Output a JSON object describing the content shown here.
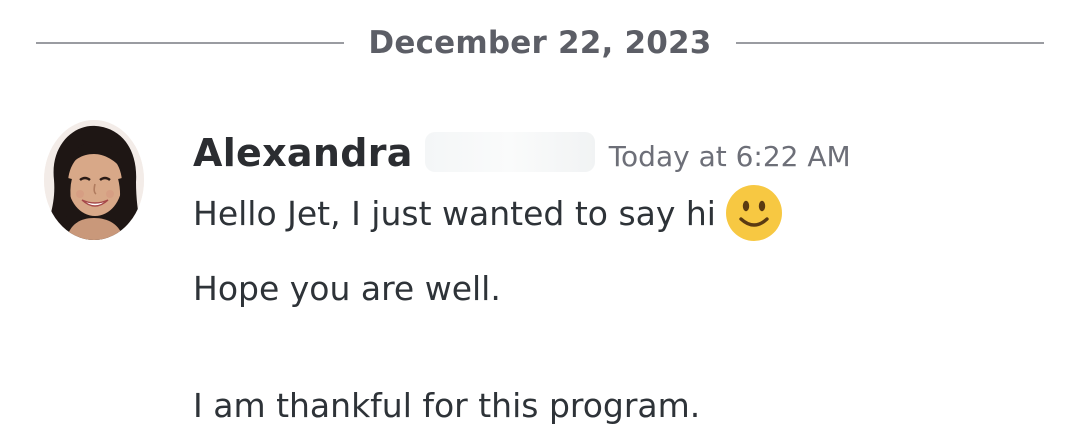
{
  "date_divider": {
    "label": "December 22, 2023"
  },
  "message": {
    "author": "Alexandra",
    "timestamp": "Today at 6:22 AM",
    "lines": [
      "Hello Jet, I just wanted to say hi",
      "Hope you are well.",
      "I am thankful for this program."
    ],
    "emoji": "slightly-smiling-face-emoji",
    "avatar": "user-avatar-photo"
  },
  "colors": {
    "divider_line": "#9a9ca1",
    "date_text": "#5c5e66",
    "author_text": "#2b2d31",
    "timestamp_text": "#6d6f78",
    "message_text": "#2e3338",
    "emoji_face": "#f7c842"
  }
}
